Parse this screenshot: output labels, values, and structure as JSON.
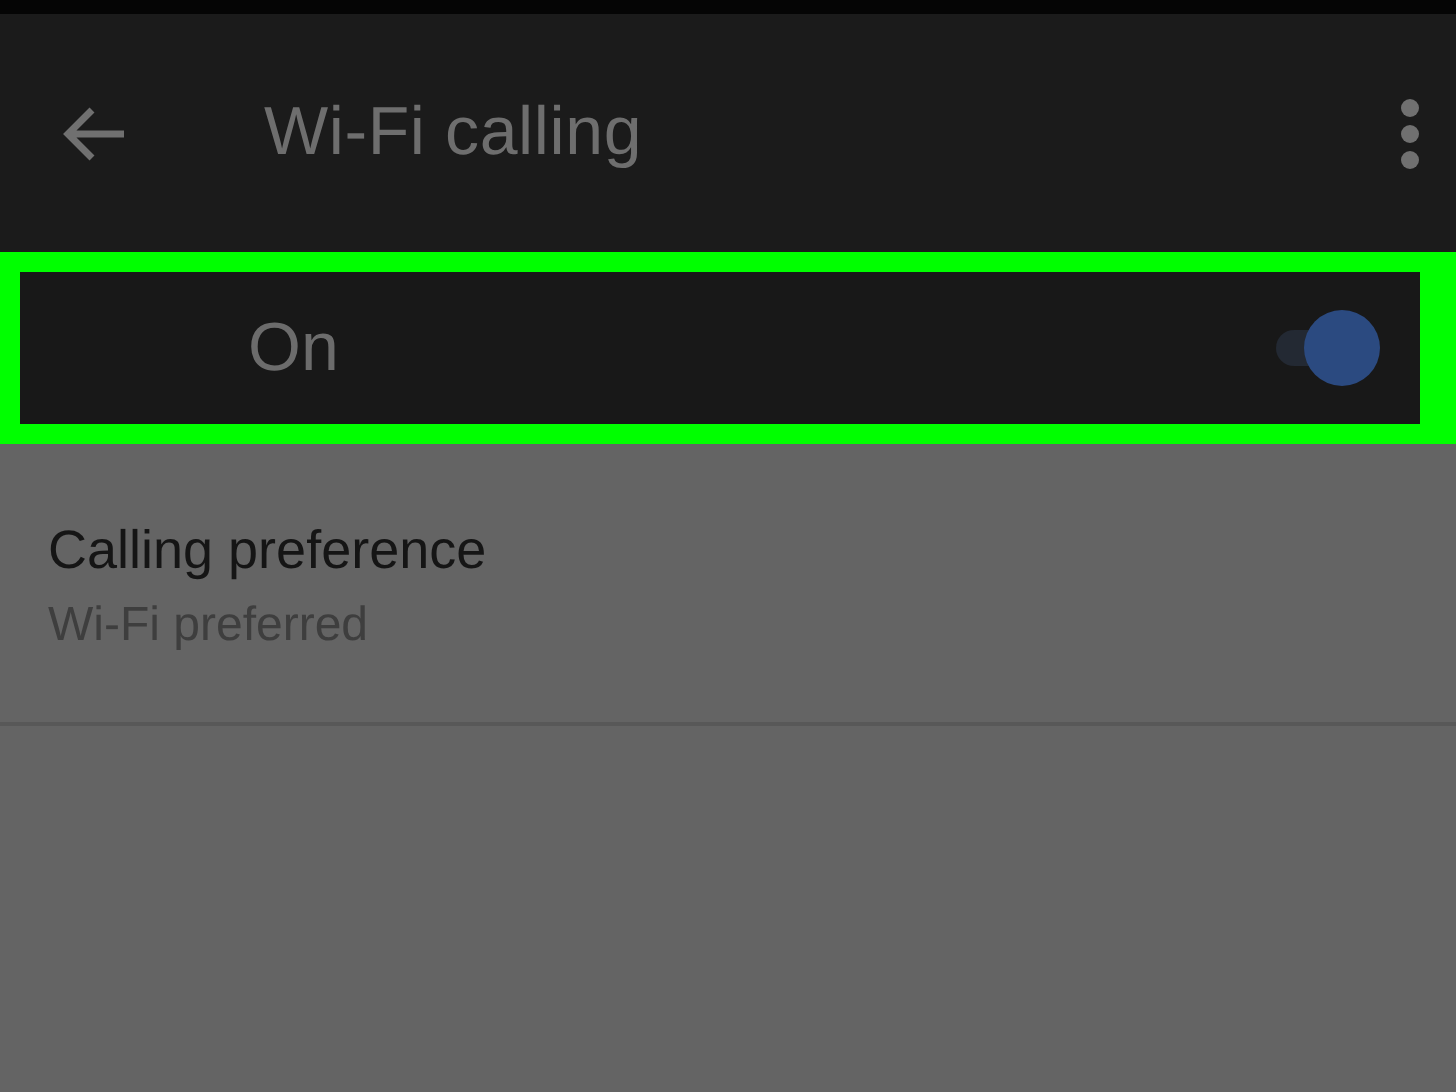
{
  "app_bar": {
    "title": "Wi-Fi calling"
  },
  "master_switch": {
    "label": "On",
    "on": true,
    "highlighted": true
  },
  "settings": [
    {
      "title": "Calling preference",
      "summary": "Wi-Fi preferred"
    }
  ]
}
